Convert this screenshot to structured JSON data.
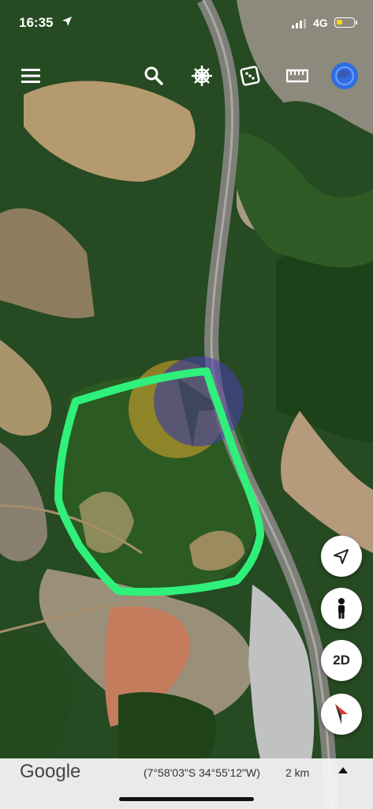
{
  "status_bar": {
    "time": "16:35",
    "network": "4G",
    "battery_color": "#f7d21e"
  },
  "toolbar": {
    "icons": [
      "menu-icon",
      "search-icon",
      "voyager-wheel-icon",
      "dice-icon",
      "ruler-icon",
      "profile-globe-icon"
    ]
  },
  "map": {
    "type": "satellite",
    "drawn_polygon_color": "#2ff07a",
    "watermark": "overlapping orange and blue translucent circular shapes with a dark arrow"
  },
  "controls": {
    "twod_label": "2D",
    "icons": [
      "location-arrow-icon",
      "pegman-icon",
      "compass-icon"
    ]
  },
  "bottom_bar": {
    "logo_text": "Google",
    "coordinates": "(7°58'03\"S 34°55'12\"W)",
    "scale": "2 km",
    "expand_icon": "caret-up-icon"
  },
  "colors": {
    "polygon": "#2ff07a",
    "forest": "#1f4a1c",
    "clearing": "#b7a177",
    "road": "#7d7d78",
    "compass_needle": "#e03a2a"
  }
}
